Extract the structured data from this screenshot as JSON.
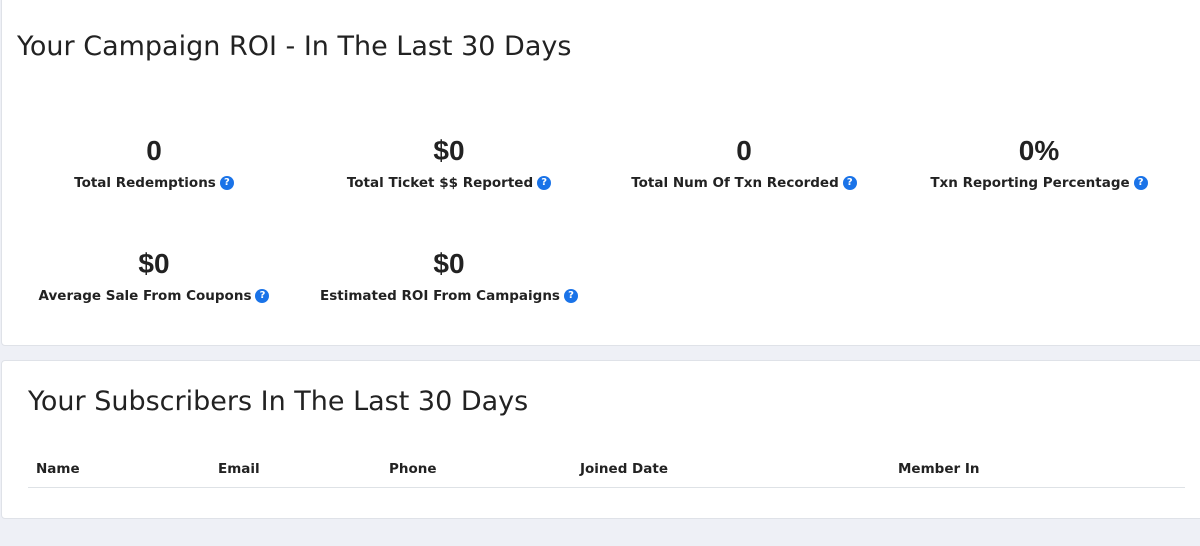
{
  "roi": {
    "title": "Your Campaign ROI - In The Last 30 Days",
    "stats": [
      {
        "value": "0",
        "label": "Total Redemptions"
      },
      {
        "value": "$0",
        "label": "Total Ticket $$ Reported"
      },
      {
        "value": "0",
        "label": "Total Num Of Txn Recorded"
      },
      {
        "value": "0%",
        "label": "Txn Reporting Percentage"
      },
      {
        "value": "$0",
        "label": "Average Sale From Coupons"
      },
      {
        "value": "$0",
        "label": "Estimated ROI From Campaigns"
      }
    ],
    "help_icon_glyph": "?"
  },
  "subscribers": {
    "title": "Your Subscribers In The Last 30 Days",
    "columns": [
      "Name",
      "Email",
      "Phone",
      "Joined Date",
      "Member In"
    ]
  },
  "colors": {
    "accent": "#1a73e8",
    "background": "#eef0f6",
    "card": "#ffffff"
  }
}
